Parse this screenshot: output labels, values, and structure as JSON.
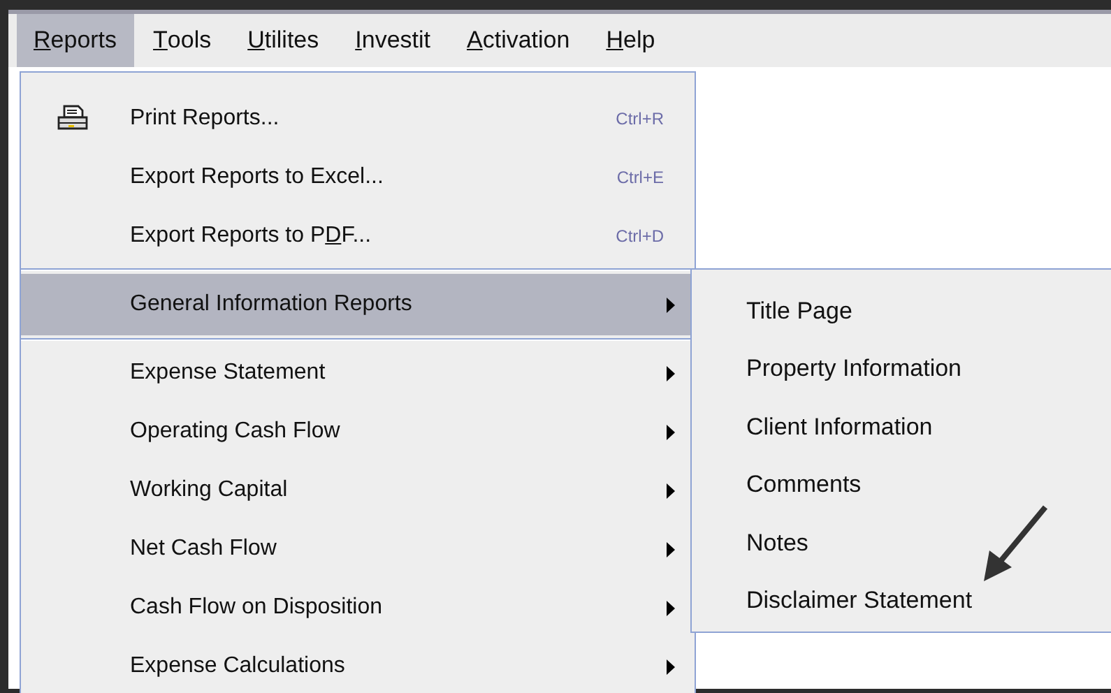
{
  "menubar": [
    {
      "key": "R",
      "post": "eports",
      "selected": true
    },
    {
      "key": "T",
      "post": "ools",
      "selected": false
    },
    {
      "key": "U",
      "post": "tilites",
      "selected": false
    },
    {
      "key": "I",
      "post": "nvestit",
      "selected": false
    },
    {
      "key": "A",
      "post": "ctivation",
      "selected": false
    },
    {
      "key": "H",
      "post": "elp",
      "selected": false
    }
  ],
  "reports_menu": {
    "items": [
      {
        "kind": "iconcommand",
        "label": {
          "pre": "Print Reports..."
        },
        "shortcut": "Ctrl+R"
      },
      {
        "kind": "command",
        "label": {
          "pre": "Export Reports to Excel..."
        },
        "shortcut": "Ctrl+E"
      },
      {
        "kind": "command",
        "label": {
          "pre": "Export Reports to P",
          "key": "D",
          "post": "F..."
        },
        "shortcut": "Ctrl+D"
      },
      {
        "kind": "separator"
      },
      {
        "kind": "submenu",
        "label": {
          "pre": "General Information Reports"
        },
        "selected": true
      },
      {
        "kind": "separator"
      },
      {
        "kind": "submenu",
        "label": {
          "pre": "Expense Statement"
        },
        "selected": false
      },
      {
        "kind": "submenu",
        "label": {
          "pre": "Operating Cash Flow"
        },
        "selected": false
      },
      {
        "kind": "submenu",
        "label": {
          "pre": "Working Capital"
        },
        "selected": false
      },
      {
        "kind": "submenu",
        "label": {
          "pre": "Net Cash Flow"
        },
        "selected": false
      },
      {
        "kind": "submenu",
        "label": {
          "pre": "Cash Flow on Disposition"
        },
        "selected": false
      },
      {
        "kind": "submenu",
        "label": {
          "pre": "Expense Calculations"
        },
        "selected": false
      }
    ]
  },
  "general_information_submenu": {
    "items": [
      {
        "label": "Title Page"
      },
      {
        "label": "Property Information"
      },
      {
        "label": "Client Information"
      },
      {
        "label": "Comments"
      },
      {
        "label": "Notes"
      },
      {
        "label": "Disclaimer Statement"
      }
    ]
  }
}
